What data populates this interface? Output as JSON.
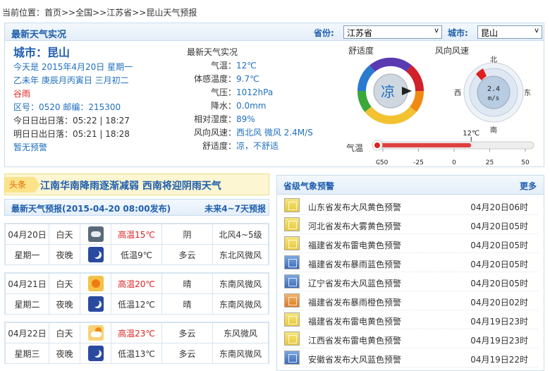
{
  "breadcrumb": "当前位置：首页>>全国>>江苏省>>昆山天气预报",
  "top": {
    "title": "最新天气实况",
    "province_label": "省份:",
    "province_value": "江苏省",
    "city_label": "城市:",
    "city_value": "昆山",
    "select_arrow": "v"
  },
  "info": {
    "city": "城市：昆山",
    "today": "今天是 2015年4月20日 星期一",
    "lunar": "乙未年 庚辰月丙寅日 三月初二",
    "solar_term": "谷雨",
    "codes": "区号：0520   邮编：215300",
    "today_sun": "今日日出日落：05:22  |  18:27",
    "tomorrow_sun": "明日日出日落：05:21  |  18:28",
    "alert": "暂无预警"
  },
  "live": {
    "title": "最新天气实况",
    "rows": [
      {
        "label": "气温：",
        "value": "12℃"
      },
      {
        "label": "体感温度：",
        "value": "9.7℃"
      },
      {
        "label": "气压：",
        "value": "1012hPa"
      },
      {
        "label": "降水：",
        "value": "0.0mm"
      },
      {
        "label": "相对湿度：",
        "value": "89%"
      },
      {
        "label": "风向风速：",
        "value": "西北风 微风 2.4M/S"
      },
      {
        "label": "舒适度：",
        "value": "凉，不舒适"
      }
    ]
  },
  "comfort": {
    "title": "舒适度",
    "value": "凉"
  },
  "wind": {
    "title": "风向风速",
    "speed": "2.4",
    "unit": "m/s",
    "north": "北",
    "south": "南",
    "east": "东",
    "west": "西"
  },
  "tempbar": {
    "title": "气温",
    "current": "12℃",
    "current_value": 12,
    "min": -50,
    "max": 50,
    "ticks": [
      "-50",
      "-25",
      "0",
      "25",
      "50"
    ],
    "unit": "C"
  },
  "headline": {
    "tag": "头条",
    "text": "江南华南降雨逐渐减弱  西南将迎阴雨天气"
  },
  "forecast": {
    "title": "最新天气预报(2015-04-20 08:00发布)",
    "more": "未来4~7天预报",
    "days": [
      {
        "date": "04月20日",
        "week": "星期一",
        "day": {
          "label": "白天",
          "icon": "cloud-icon",
          "temp": "高温15℃",
          "weather": "阴",
          "wind": "北风4~5级"
        },
        "night": {
          "label": "夜晚",
          "icon": "moon-icon",
          "temp": "低温9℃",
          "weather": "多云",
          "wind": "东北风微风"
        }
      },
      {
        "date": "04月21日",
        "week": "星期二",
        "day": {
          "label": "白天",
          "icon": "sun-icon",
          "temp": "高温20℃",
          "weather": "晴",
          "wind": "东南风微风"
        },
        "night": {
          "label": "夜晚",
          "icon": "moon-icon",
          "temp": "低温12℃",
          "weather": "晴",
          "wind": "东南风微风"
        }
      },
      {
        "date": "04月22日",
        "week": "星期三",
        "day": {
          "label": "白天",
          "icon": "partly-cloudy-icon",
          "temp": "高温23℃",
          "weather": "多云",
          "wind": "东风微风"
        },
        "night": {
          "label": "夜晚",
          "icon": "moon-icon",
          "temp": "低温13℃",
          "weather": "多云",
          "wind": "东南风微风"
        }
      }
    ]
  },
  "warnings": {
    "title": "省级气象预警",
    "more": "更多",
    "items": [
      {
        "text": "山东省发布大风黄色预警",
        "time": "04月20日06时",
        "color": "yellow"
      },
      {
        "text": "河北省发布大雾黄色预警",
        "time": "04月20日05时",
        "color": "yellow"
      },
      {
        "text": "福建省发布雷电黄色预警",
        "time": "04月20日05时",
        "color": "yellow"
      },
      {
        "text": "福建省发布暴雨蓝色预警",
        "time": "04月20日05时",
        "color": "blue"
      },
      {
        "text": "辽宁省发布大风蓝色预警",
        "time": "04月20日05时",
        "color": "blue"
      },
      {
        "text": "福建省发布暴雨橙色预警",
        "time": "04月20日02时",
        "color": "orange"
      },
      {
        "text": "福建省发布雷电黄色预警",
        "time": "04月19日23时",
        "color": "yellow"
      },
      {
        "text": "江西省发布雷电黄色预警",
        "time": "04月19日23时",
        "color": "yellow"
      },
      {
        "text": "安徽省发布大风蓝色预警",
        "time": "04月19日22时",
        "color": "blue"
      }
    ]
  }
}
